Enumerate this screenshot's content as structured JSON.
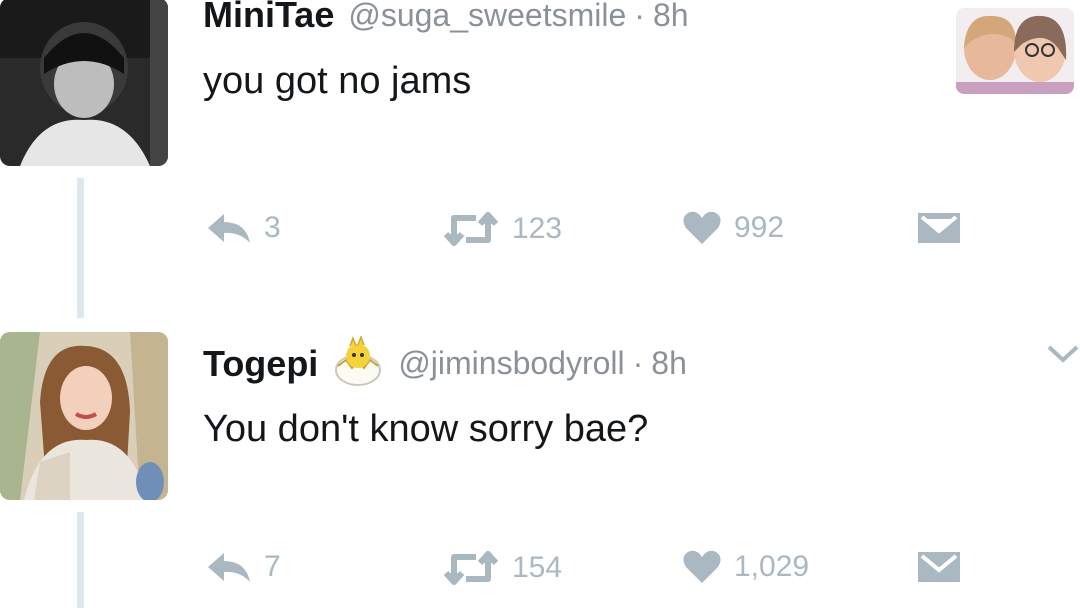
{
  "tweets": [
    {
      "name": "MiniTae",
      "handle": "@suga_sweetsmile",
      "time": "8h",
      "text": "you got no jams",
      "replies": "3",
      "retweets": "123",
      "likes": "992"
    },
    {
      "name": "Togepi",
      "handle": "@jiminsbodyroll",
      "time": "8h",
      "text": "You don't know sorry bae?",
      "replies": "7",
      "retweets": "154",
      "likes": "1,029"
    }
  ],
  "separator": "·",
  "icons": {
    "reply": "reply-icon",
    "retweet": "retweet-icon",
    "like": "heart-icon",
    "message": "envelope-icon",
    "more": "chevron-down-icon",
    "badge": "togepi-emoji-icon"
  },
  "colors": {
    "text": "#14171a",
    "muted": "#8a9198",
    "action": "#aab8c2",
    "thread_line": "#e1e8ed"
  }
}
